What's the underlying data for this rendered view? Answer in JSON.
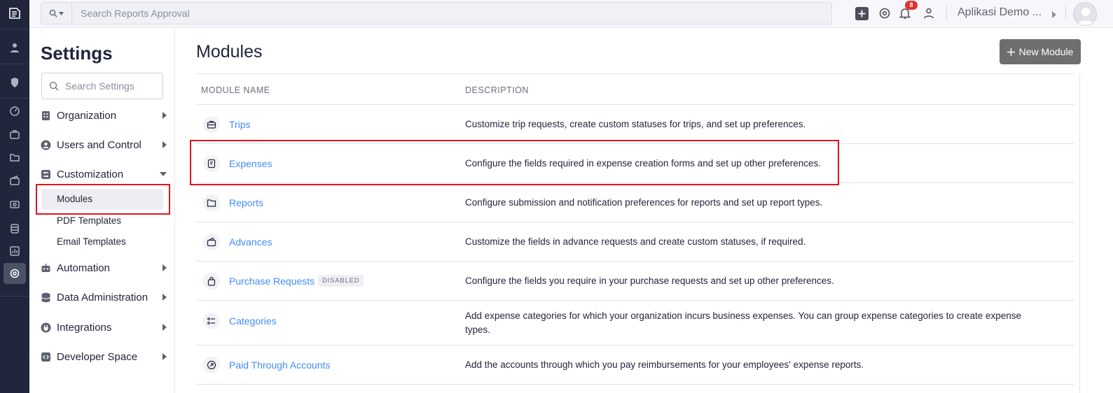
{
  "topbar": {
    "search_placeholder": "Search Reports Approval",
    "notification_count": "8",
    "org_name": "Aplikasi Demo ..."
  },
  "settings": {
    "title": "Settings",
    "search_placeholder": "Search Settings",
    "items": [
      {
        "label": "Organization"
      },
      {
        "label": "Users and Control"
      },
      {
        "label": "Customization"
      },
      {
        "label": "Automation"
      },
      {
        "label": "Data Administration"
      },
      {
        "label": "Integrations"
      },
      {
        "label": "Developer Space"
      }
    ],
    "sub_items": [
      {
        "label": "Modules"
      },
      {
        "label": "PDF Templates"
      },
      {
        "label": "Email Templates"
      }
    ]
  },
  "main": {
    "title": "Modules",
    "new_button": "New Module",
    "columns": [
      "MODULE NAME",
      "DESCRIPTION"
    ],
    "rows": [
      {
        "name": "Trips",
        "description": "Customize trip requests, create custom statuses for trips, and set up preferences."
      },
      {
        "name": "Expenses",
        "description": "Configure the fields required in expense creation forms and set up other preferences."
      },
      {
        "name": "Reports",
        "description": "Configure submission and notification preferences for reports and set up report types."
      },
      {
        "name": "Advances",
        "description": "Customize the fields in advance requests and create custom statuses, if required."
      },
      {
        "name": "Purchase Requests",
        "badge": "DISABLED",
        "description": "Configure the fields you require in your purchase requests and set up other preferences."
      },
      {
        "name": "Categories",
        "description": "Add expense categories for which your organization incurs business expenses. You can group expense categories to create expense types."
      },
      {
        "name": "Paid Through Accounts",
        "description": "Add the accounts through which you pay reimbursements for your employees' expense reports."
      }
    ]
  },
  "colors": {
    "rail_bg": "#21263c",
    "link_blue": "#408dfb",
    "highlight_red": "#e0141e",
    "button_gray": "#6d6e70"
  }
}
